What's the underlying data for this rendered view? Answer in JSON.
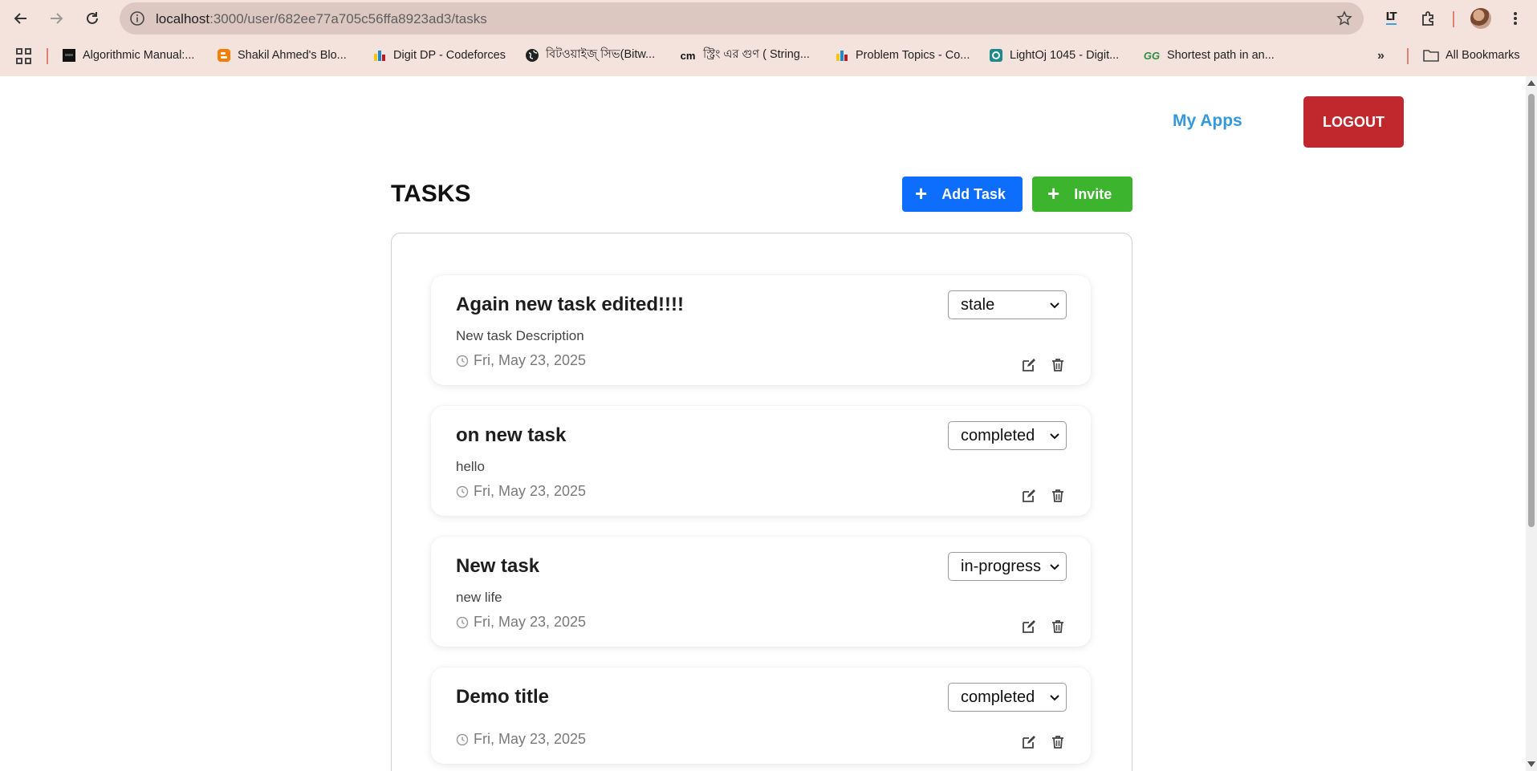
{
  "browser": {
    "url_host": "localhost",
    "url_path": ":3000/user/682ee77a705c56ffa8923ad3/tasks",
    "extension_label": "LT",
    "bookmarks": [
      {
        "label": "Algorithmic Manual:...",
        "icon": "dark-square-icon"
      },
      {
        "label": "Shakil Ahmed's Blo...",
        "icon": "blogger-icon"
      },
      {
        "label": "Digit DP - Codeforces",
        "icon": "codeforces-icon"
      },
      {
        "label": "বিটওয়াইজ্ সিভ(Bitw...",
        "icon": "globe-icon"
      },
      {
        "label": "স্ট্রিং এর গুণ ( String...",
        "icon": "cm-icon",
        "prefix": "cm"
      },
      {
        "label": "Problem Topics - Co...",
        "icon": "codeforces-icon"
      },
      {
        "label": "LightOj 1045 - Digit...",
        "icon": "lightoj-icon"
      },
      {
        "label": "Shortest path in an...",
        "icon": "geeksforgeeks-icon",
        "prefix": "GG"
      }
    ],
    "all_bookmarks": "All Bookmarks"
  },
  "nav": {
    "my_apps": "My Apps",
    "logout": "LOGOUT"
  },
  "tasks": {
    "title": "TASKS",
    "add_task": "Add Task",
    "invite": "Invite",
    "plus": "+"
  },
  "cards": [
    {
      "title": "Again new task edited!!!!",
      "description": "New task Description",
      "date": "Fri, May 23, 2025",
      "status": "stale"
    },
    {
      "title": "on new task",
      "description": "hello",
      "date": "Fri, May 23, 2025",
      "status": "completed"
    },
    {
      "title": "New task",
      "description": "new life",
      "date": "Fri, May 23, 2025",
      "status": "in-progress"
    },
    {
      "title": "Demo title",
      "description": "",
      "date": "Fri, May 23, 2025",
      "status": "completed"
    }
  ],
  "colors": {
    "chrome_bg": "#f4e3dd",
    "omnibox_bg": "#dcc8c1",
    "link_blue": "#3498db",
    "logout_red": "#c0282d",
    "add_blue": "#0d6efd",
    "invite_green": "#3db42e"
  }
}
